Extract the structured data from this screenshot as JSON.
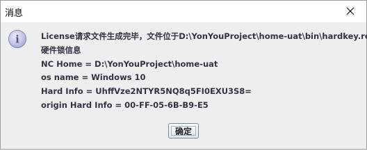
{
  "window": {
    "title": "消息"
  },
  "icon": {
    "name": "info-icon",
    "glyph": "i"
  },
  "message": {
    "lines": [
      "License请求文件生成完毕，文件位于D:\\YonYouProject\\home-uat\\bin\\hardkey.req",
      "硬件锁信息",
      "NC Home = D:\\YonYouProject\\home-uat",
      "os name = Windows 10",
      "Hard Info = UhffVze2NTYR5NQ8q5FI0EXU3S8=",
      "origin Hard Info = 00-FF-05-6B-B9-E5"
    ]
  },
  "buttons": {
    "ok_label": "确定"
  }
}
